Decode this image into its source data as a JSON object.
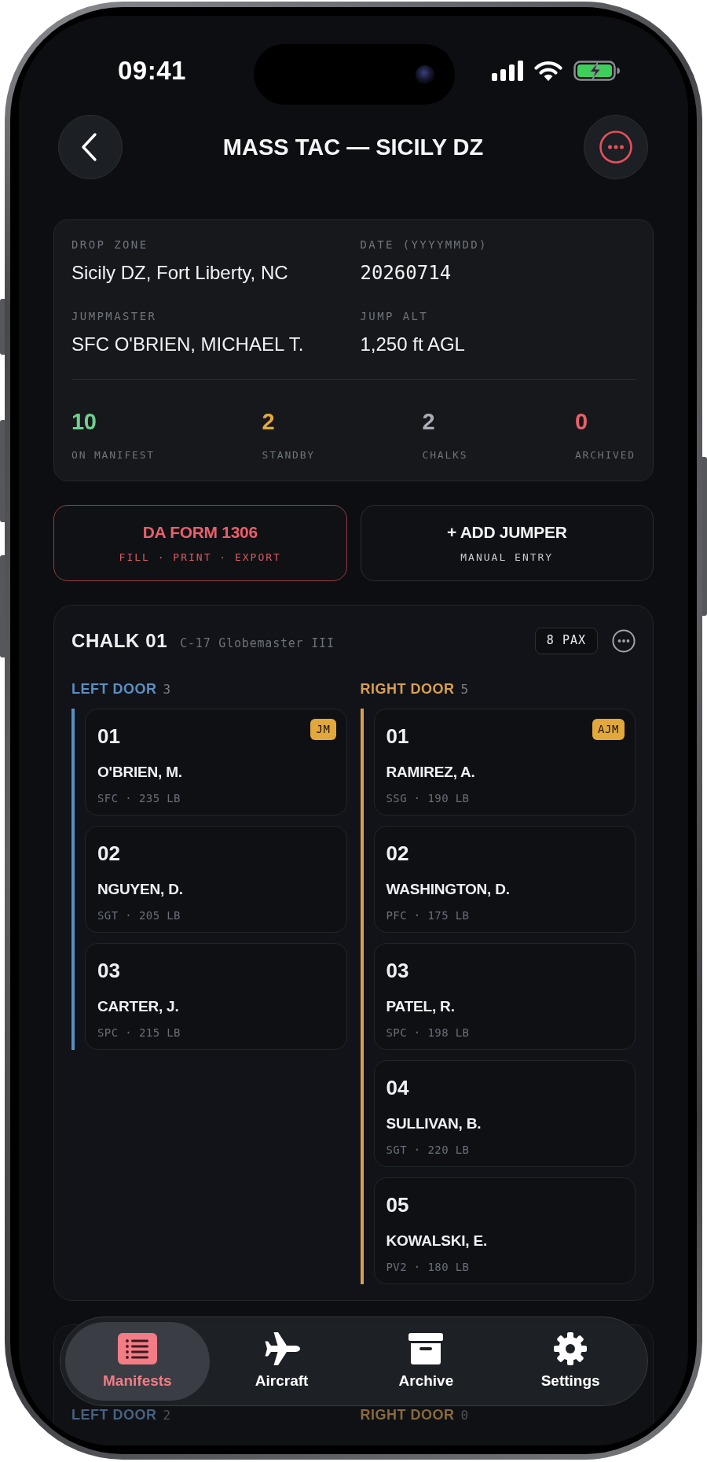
{
  "status_bar": {
    "time": "09:41"
  },
  "header": {
    "title": "MASS TAC — SICILY DZ"
  },
  "summary": {
    "fields": [
      {
        "label": "DROP ZONE",
        "value": "Sicily DZ, Fort Liberty, NC",
        "kind": "text"
      },
      {
        "label": "DATE (YYYYMMDD)",
        "value": "20260714",
        "kind": "mono"
      },
      {
        "label": "JUMPMASTER",
        "value": "SFC O'BRIEN, MICHAEL T.",
        "kind": "text"
      },
      {
        "label": "JUMP ALT",
        "value": "1,250 ft AGL",
        "kind": "text"
      }
    ],
    "stats": [
      {
        "value": "10",
        "label": "ON MANIFEST",
        "color": "#6fcf8f"
      },
      {
        "value": "2",
        "label": "STANDBY",
        "color": "#e5a93a"
      },
      {
        "value": "2",
        "label": "CHALKS",
        "color": "#a9adb5"
      },
      {
        "value": "0",
        "label": "ARCHIVED",
        "color": "#e8606a"
      }
    ]
  },
  "actions": [
    {
      "title": "DA FORM 1306",
      "subtitle": "FILL · PRINT · EXPORT",
      "kind": "primary"
    },
    {
      "title": "+ ADD JUMPER",
      "subtitle": "MANUAL ENTRY",
      "kind": "secondary"
    }
  ],
  "chalks": [
    {
      "name": "CHALK 01",
      "aircraft": "C-17 Globemaster III",
      "pax": "8 PAX",
      "doors": [
        {
          "label": "LEFT DOOR",
          "count": "3",
          "color": "#5b8fc4",
          "jumpers": [
            {
              "number": "01",
              "name": "O'BRIEN, M.",
              "details": "SFC · 235 LB",
              "badge": "JM"
            },
            {
              "number": "02",
              "name": "NGUYEN, D.",
              "details": "SGT · 205 LB"
            },
            {
              "number": "03",
              "name": "CARTER, J.",
              "details": "SPC · 215 LB"
            }
          ]
        },
        {
          "label": "RIGHT DOOR",
          "count": "5",
          "color": "#d9a04e",
          "jumpers": [
            {
              "number": "01",
              "name": "RAMIREZ, A.",
              "details": "SSG · 190 LB",
              "badge": "AJM"
            },
            {
              "number": "02",
              "name": "WASHINGTON, D.",
              "details": "PFC · 175 LB"
            },
            {
              "number": "03",
              "name": "PATEL, R.",
              "details": "SPC · 198 LB"
            },
            {
              "number": "04",
              "name": "SULLIVAN, B.",
              "details": "SGT · 220 LB"
            },
            {
              "number": "05",
              "name": "KOWALSKI, E.",
              "details": "PV2 · 180 LB"
            }
          ]
        }
      ]
    },
    {
      "doors": [
        {
          "label": "LEFT DOOR",
          "count": "2",
          "color": "#47617f"
        },
        {
          "label": "RIGHT DOOR",
          "count": "0",
          "color": "#8a6a3c"
        }
      ]
    }
  ],
  "tabs": [
    {
      "label": "Manifests",
      "selected": true
    },
    {
      "label": "Aircraft",
      "selected": false
    },
    {
      "label": "Archive",
      "selected": false
    },
    {
      "label": "Settings",
      "selected": false
    }
  ]
}
